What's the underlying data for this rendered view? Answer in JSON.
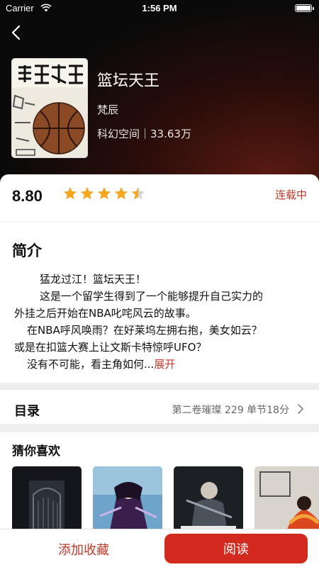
{
  "status_bar": {
    "carrier": "Carrier",
    "time": "1:56 PM"
  },
  "book": {
    "cover_text_top": "篮坛天王",
    "title": "篮坛天王",
    "author": "梵辰",
    "meta": "科幻空间｜33.63万"
  },
  "rating": {
    "score": "8.80",
    "stars": 4.5,
    "status": "连载中"
  },
  "intro": {
    "heading": "简介",
    "lines": [
      "猛龙过江！篮坛天王！",
      "这是一个留学生得到了一个能够提升自己实力的",
      "外挂之后开始在NBA叱咤风云的故事。",
      "在NBA呼风唤雨？在好莱坞左拥右抱，美女如云？",
      "或是在扣篮大赛上让文斯卡特惊呼UFO？",
      "没有不可能，看主角如何..."
    ],
    "more_label": "展开"
  },
  "toc": {
    "label": "目录",
    "latest": "第二卷璀璨 229 单节18分"
  },
  "recommend": {
    "heading": "猜你喜欢",
    "covers": [
      "dark-gate",
      "warrior-purple",
      "armored-hero",
      "fire-dunk"
    ]
  },
  "actions": {
    "favorite_label": "添加收藏",
    "read_label": "阅读"
  },
  "colors": {
    "accent": "#d22a1f",
    "star": "#f5a623",
    "hero_bg": "#0b0b0b"
  }
}
